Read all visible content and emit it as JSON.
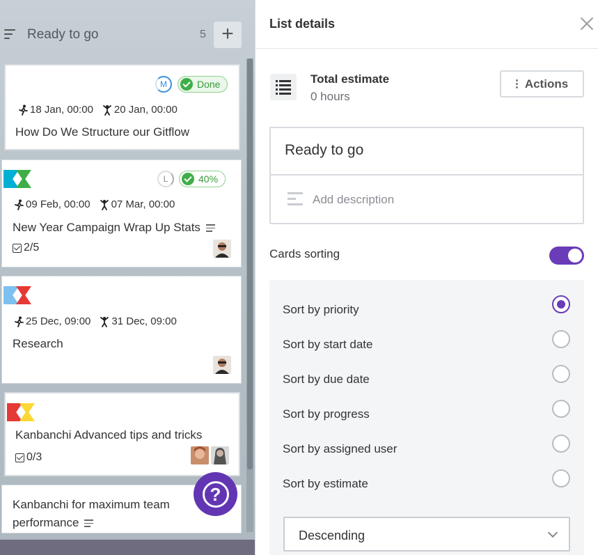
{
  "colors": {
    "accent": "#6a3cb8",
    "done_green": "#3fae49",
    "tag_cyan": "#00b0d4",
    "tag_green": "#3fae49",
    "tag_lightblue": "#7ec0f0",
    "tag_red": "#e53935",
    "tag_yellow": "#fdd835"
  },
  "board": {
    "list_title": "Ready to go",
    "card_count": "5",
    "add_label": "+",
    "cards": [
      {
        "title": "How Do We Structure our Gitflow",
        "start": "18 Jan, 00:00",
        "due": "20 Jan, 00:00",
        "priority": "M",
        "status": "Done"
      },
      {
        "title": "New Year Campaign Wrap Up Stats",
        "start": "09 Feb, 00:00",
        "due": "07 Mar, 00:00",
        "priority": "L",
        "status": "40%",
        "checklist": "2/5",
        "tags": [
          "cyan",
          "green"
        ]
      },
      {
        "title": "Research",
        "start": "25 Dec, 09:00",
        "due": "31 Dec, 09:00",
        "tags": [
          "lightblue",
          "red"
        ]
      },
      {
        "title": "Kanbanchi Advanced tips and tricks",
        "checklist": "0/3",
        "tags": [
          "red",
          "yellow"
        ]
      },
      {
        "title_line1": "Kanbanchi for maximum team",
        "title_line2": "performance"
      }
    ],
    "help_label": "?"
  },
  "panel": {
    "title": "List details",
    "estimate_label": "Total estimate",
    "estimate_value": "0 hours",
    "actions_label": "Actions",
    "list_name": "Ready to go",
    "description_placeholder": "Add description",
    "cards_sorting_label": "Cards sorting",
    "cards_sorting_enabled": true,
    "sort_options": [
      {
        "label": "Sort by priority",
        "selected": true
      },
      {
        "label": "Sort by start date",
        "selected": false
      },
      {
        "label": "Sort by due date",
        "selected": false
      },
      {
        "label": "Sort by progress",
        "selected": false
      },
      {
        "label": "Sort by assigned user",
        "selected": false
      },
      {
        "label": "Sort by estimate",
        "selected": false
      }
    ],
    "order_value": "Descending"
  }
}
